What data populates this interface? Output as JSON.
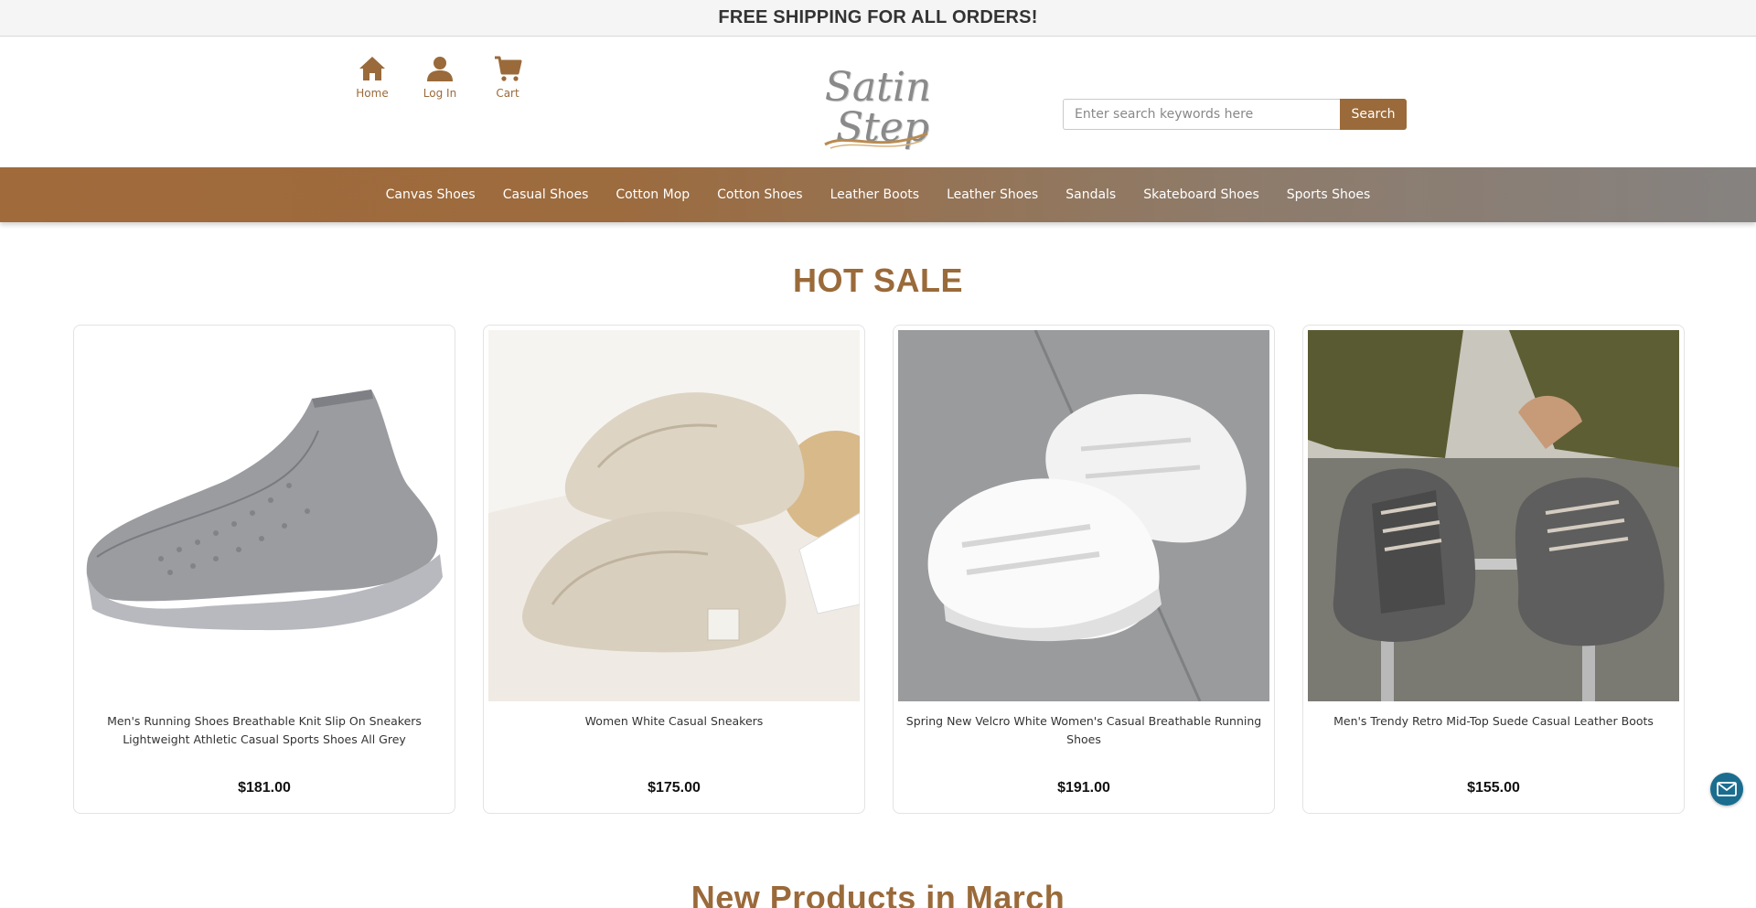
{
  "announcement": "FREE SHIPPING FOR ALL ORDERS!",
  "quick_nav": [
    {
      "label": "Home",
      "icon": "home-icon"
    },
    {
      "label": "Log In",
      "icon": "user-icon"
    },
    {
      "label": "Cart",
      "icon": "cart-icon"
    }
  ],
  "logo": {
    "line1": "Satin",
    "line2": "Step"
  },
  "search": {
    "placeholder": "Enter search keywords here",
    "value": "",
    "button_label": "Search"
  },
  "categories": [
    "Canvas Shoes",
    "Casual Shoes",
    "Cotton Mop",
    "Cotton Shoes",
    "Leather Boots",
    "Leather Shoes",
    "Sandals",
    "Skateboard Shoes",
    "Sports Shoes"
  ],
  "hot_sale": {
    "title": "HOT SALE",
    "products": [
      {
        "name": "Men's Running Shoes Breathable Knit Slip On Sneakers Lightweight Athletic Casual Sports Shoes All Grey",
        "price": "$181.00"
      },
      {
        "name": "Women White Casual Sneakers",
        "price": "$175.00"
      },
      {
        "name": "Spring New Velcro White Women's Casual Breathable Running Shoes",
        "price": "$191.00"
      },
      {
        "name": "Men's Trendy Retro Mid-Top Suede Casual Leather Boots",
        "price": "$155.00"
      }
    ]
  },
  "new_products": {
    "title": "New Products in March"
  },
  "colors": {
    "brand_brown": "#9a6a3a",
    "mail_button": "#1a6d8f"
  },
  "floating": {
    "icon": "mail-icon"
  }
}
